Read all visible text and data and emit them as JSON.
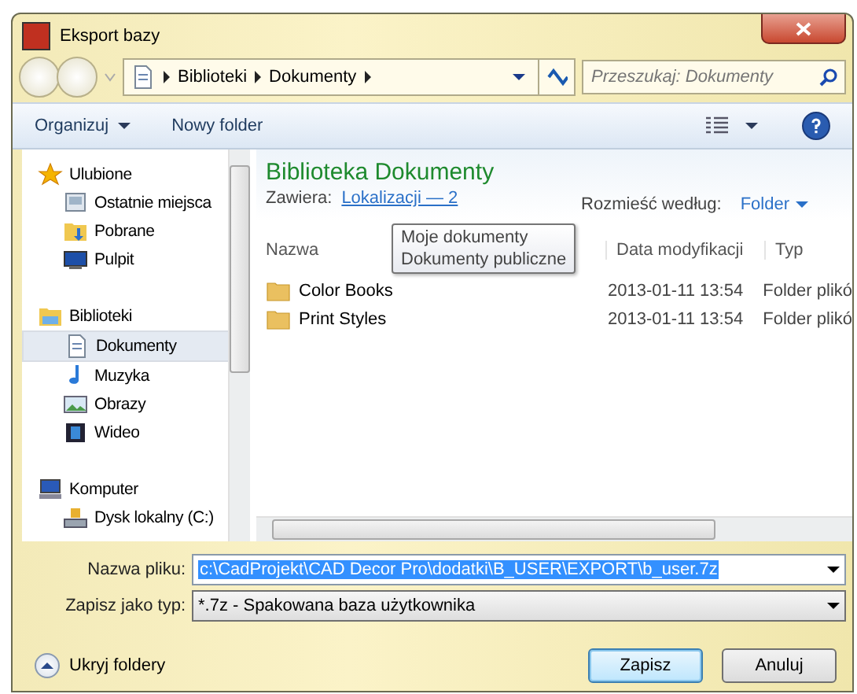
{
  "window": {
    "title": "Eksport bazy"
  },
  "breadcrumb": [
    "Biblioteki",
    "Dokumenty"
  ],
  "search": {
    "placeholder": "Przeszukaj: Dokumenty"
  },
  "toolbar": {
    "organize": "Organizuj",
    "new_folder": "Nowy folder"
  },
  "sidebar": {
    "groups": [
      {
        "label": "Ulubione",
        "kind": "star",
        "selected": false,
        "children": [
          {
            "label": "Ostatnie miejsca",
            "kind": "recent",
            "selected": false
          },
          {
            "label": "Pobrane",
            "kind": "download",
            "selected": false
          },
          {
            "label": "Pulpit",
            "kind": "desktop",
            "selected": false
          }
        ]
      },
      {
        "label": "Biblioteki",
        "kind": "library",
        "selected": false,
        "children": [
          {
            "label": "Dokumenty",
            "kind": "document",
            "selected": true
          },
          {
            "label": "Muzyka",
            "kind": "music",
            "selected": false
          },
          {
            "label": "Obrazy",
            "kind": "image",
            "selected": false
          },
          {
            "label": "Wideo",
            "kind": "video",
            "selected": false
          }
        ]
      },
      {
        "label": "Komputer",
        "kind": "computer",
        "selected": false,
        "children": [
          {
            "label": "Dysk lokalny (C:)",
            "kind": "drive",
            "selected": false
          }
        ]
      }
    ]
  },
  "library": {
    "title": "Biblioteka Dokumenty",
    "contains_label": "Zawiera:",
    "locations_link": "Lokalizacji — 2",
    "arrange_label": "Rozmieść według:",
    "arrange_value": "Folder"
  },
  "tooltip": [
    "Moje dokumenty",
    "Dokumenty publiczne"
  ],
  "table": {
    "columns": [
      "Nazwa",
      "Data modyfikacji",
      "Typ"
    ],
    "rows": [
      {
        "name": "Color Books",
        "date": "2013-01-11 13:54",
        "type": "Folder plikó"
      },
      {
        "name": "Print Styles",
        "date": "2013-01-11 13:54",
        "type": "Folder plikó"
      }
    ]
  },
  "form": {
    "filename_label": "Nazwa pliku:",
    "filename": "c:\\CadProjekt\\CAD Decor Pro\\dodatki\\B_USER\\EXPORT\\b_user.7z",
    "type_label": "Zapisz jako typ:",
    "type_value": "*.7z - Spakowana baza użytkownika"
  },
  "hide_folders": "Ukryj foldery",
  "buttons": [
    {
      "label": "Zapisz",
      "default": true
    },
    {
      "label": "Anuluj",
      "default": false
    }
  ]
}
